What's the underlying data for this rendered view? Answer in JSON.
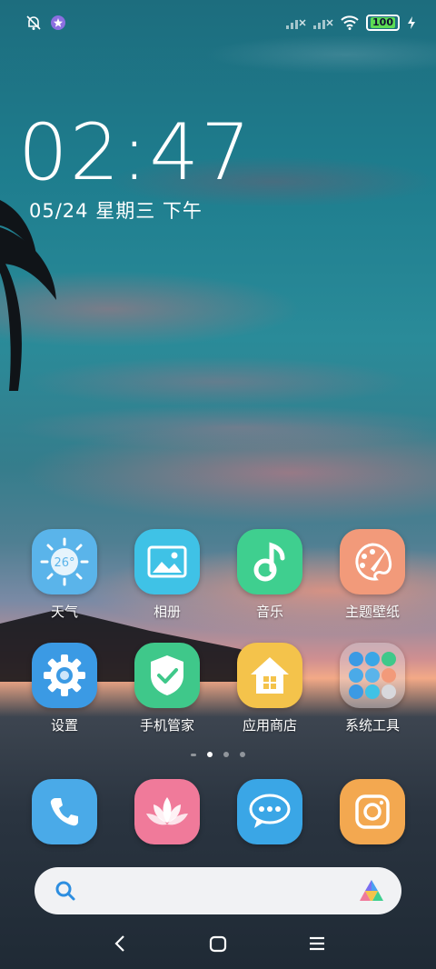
{
  "status_bar": {
    "battery": "100",
    "icons": [
      "bell-off-icon",
      "app-badge-icon",
      "signal-off-icon",
      "signal-off-icon",
      "wifi-icon",
      "charging-icon"
    ]
  },
  "lock": {
    "time": "02:47",
    "date": "05/24 星期三 下午"
  },
  "home": {
    "row1": [
      {
        "label": "天气",
        "icon": "weather-icon",
        "temp": "26°"
      },
      {
        "label": "相册",
        "icon": "gallery-icon"
      },
      {
        "label": "音乐",
        "icon": "music-icon"
      },
      {
        "label": "主题壁纸",
        "icon": "theme-icon"
      }
    ],
    "row2": [
      {
        "label": "设置",
        "icon": "settings-icon"
      },
      {
        "label": "手机管家",
        "icon": "security-icon"
      },
      {
        "label": "应用商店",
        "icon": "app-store-icon"
      },
      {
        "label": "系统工具",
        "icon": "folder-icon"
      }
    ],
    "page_indicator": {
      "count": 4,
      "current": 2
    },
    "dock": [
      {
        "name": "phone",
        "icon": "phone-icon"
      },
      {
        "name": "photos",
        "icon": "lotus-icon"
      },
      {
        "name": "messages",
        "icon": "message-icon"
      },
      {
        "name": "camera",
        "icon": "camera-icon"
      }
    ]
  },
  "search": {
    "icon": "search-icon",
    "assistant_icon": "assistant-logo-icon"
  },
  "nav": {
    "back": "back-icon",
    "home": "home-icon",
    "menu": "menu-icon"
  },
  "colors": {
    "weather": "#5ab4ea",
    "gallery": "#3fc2e6",
    "music": "#3fcf8f",
    "theme": "#f29a7a",
    "settings": "#3b9ae4",
    "security": "#3fc88a",
    "store": "#f4c34b",
    "phone": "#4aaae8",
    "photos": "#f07a9a",
    "messages": "#3aa6e6",
    "camera": "#f3a850"
  }
}
